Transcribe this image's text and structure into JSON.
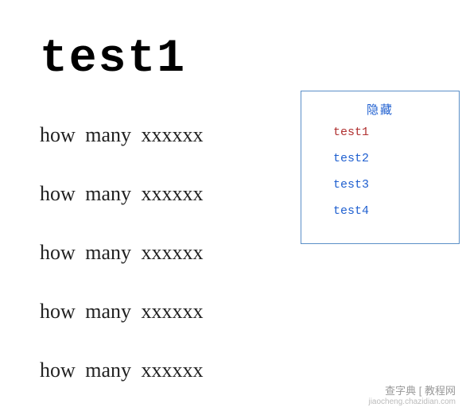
{
  "title": "test1",
  "lines": [
    "how many xxxxxx",
    "how many xxxxxx",
    "how many xxxxxx",
    "how many xxxxxx",
    "how many xxxxxx"
  ],
  "toc": {
    "header": "隐藏",
    "items": [
      {
        "label": "test1",
        "active": true
      },
      {
        "label": "test2",
        "active": false
      },
      {
        "label": "test3",
        "active": false
      },
      {
        "label": "test4",
        "active": false
      }
    ]
  },
  "watermark": {
    "main": "查字典 [ 教程网",
    "sub": "jiaocheng.chazidian.com"
  }
}
